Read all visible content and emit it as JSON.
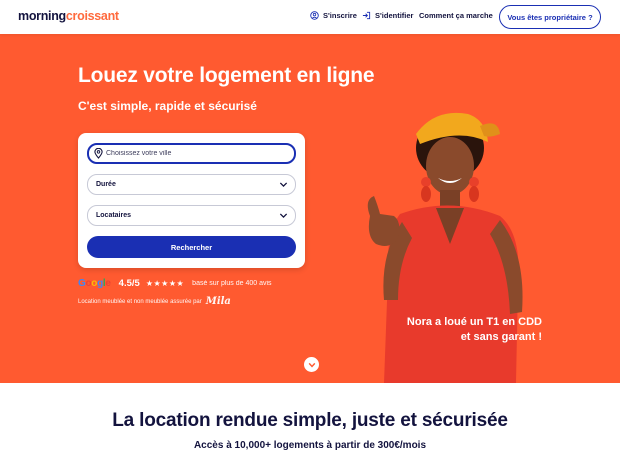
{
  "header": {
    "logo_part1": "morning",
    "logo_part2": "croissant",
    "signup": "S'inscrire",
    "login": "S'identifier",
    "how_it_works": "Comment ça marche",
    "owner_cta": "Vous êtes propriétaire ?"
  },
  "hero": {
    "title": "Louez votre logement en ligne",
    "subtitle": "C'est simple, rapide et sécurisé",
    "search": {
      "city_placeholder": "Choisissez votre ville",
      "duration_label": "Durée",
      "tenants_label": "Locataires",
      "submit_label": "Rechercher"
    },
    "rating": {
      "google_letters": [
        "G",
        "o",
        "o",
        "g",
        "l",
        "e"
      ],
      "value": "4.5/5",
      "stars": "★★★★★",
      "reviews_text": "basé sur plus de 400 avis"
    },
    "assurance_text": "Location meublée et non meublée assurée par",
    "assurance_brand": "Mila",
    "testimonial_line1": "Nora a loué un T1 en CDD",
    "testimonial_line2": "et sans garant !"
  },
  "section": {
    "title": "La location rendue simple, juste et sécurisée",
    "subtitle": "Accès à 10,000+ logements à partir de 300€/mois"
  },
  "colors": {
    "hero_bg": "#ff5a30",
    "primary_blue": "#1a2fb3",
    "navy_text": "#13133e",
    "logo_accent": "#ff6a3d"
  },
  "icons": {
    "signup": "user-circle-icon",
    "login": "login-arrow-icon",
    "city": "location-pin-icon",
    "dropdown": "chevron-down-icon",
    "scroll": "chevron-down-circle-icon"
  }
}
